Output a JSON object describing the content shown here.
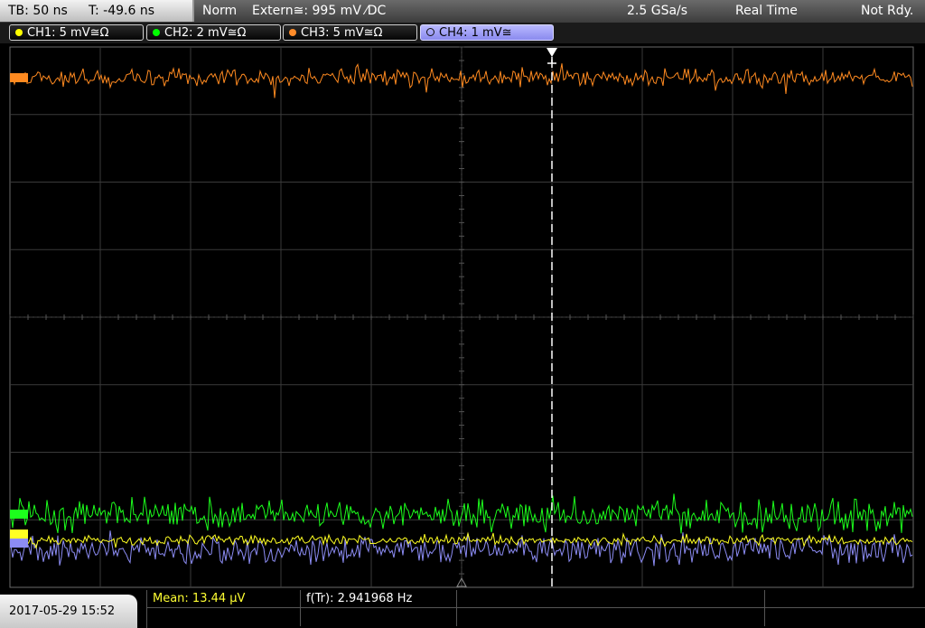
{
  "topbar": {
    "timebase": "TB: 50 ns",
    "trigger_time": "T: -49.6 ns",
    "trigger_mode": "Norm",
    "trigger_source": "Extern≅: 995 mV ⁄DC",
    "sample_rate": "2.5 GSa/s",
    "acq_mode": "Real Time",
    "status": "Not Rdy."
  },
  "channels": [
    {
      "label": "CH1: 5 mV≅Ω",
      "color": "#ffff00",
      "active": false
    },
    {
      "label": "CH2: 2 mV≅Ω",
      "color": "#00ff00",
      "active": false
    },
    {
      "label": "CH3: 5 mV≅Ω",
      "color": "#ff8c2a",
      "active": false
    },
    {
      "label": "CH4: 1 mV≅",
      "color": "#9a9aff",
      "active": true
    }
  ],
  "traces": {
    "ch1_color": "#ffff22",
    "ch2_color": "#1cff1c",
    "ch3_color": "#ff8a20",
    "ch4_color": "#8c8cf4"
  },
  "bottom": {
    "datetime": "2017-05-29 15:52",
    "mean": "Mean: 13.44 µV",
    "frequency": "f(Tr): 2.941968 Hz"
  }
}
